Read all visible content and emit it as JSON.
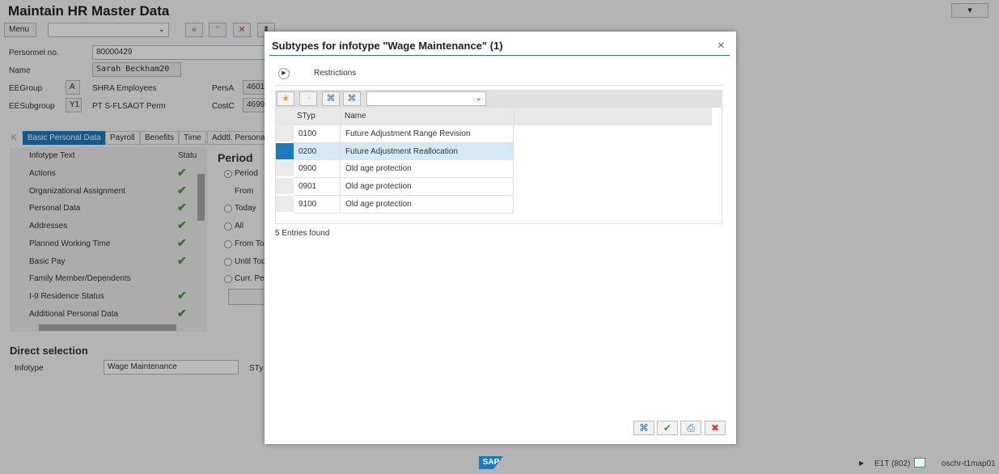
{
  "app": {
    "title": "Maintain HR Master Data",
    "menu_label": "Menu",
    "command_field": ""
  },
  "header": {
    "personnel_no_label": "Personnel no.",
    "personnel_no": "80000429",
    "name_label": "Name",
    "name": "Sarah Beckham20",
    "eegroup_label": "EEGroup",
    "eegroup_code": "A",
    "eegroup_text": "SHRA Employees",
    "eesubgroup_label": "EESubgroup",
    "eesubgroup_code": "Y1",
    "eesubgroup_text": "PT S-FLSAOT Perm",
    "persa_label": "PersA",
    "persa": "4601",
    "costc_label": "CostC",
    "costc": "4699"
  },
  "tabs": [
    "Basic Personal Data",
    "Payroll",
    "Benefits",
    "Time",
    "Addtl. Persona"
  ],
  "infotypes": {
    "col_text": "Infotype Text",
    "col_status": "Statu",
    "rows": [
      {
        "text": "Actions",
        "ok": true
      },
      {
        "text": "Organizational Assignment",
        "ok": true
      },
      {
        "text": "Personal Data",
        "ok": true
      },
      {
        "text": "Addresses",
        "ok": true
      },
      {
        "text": "Planned Working Time",
        "ok": true
      },
      {
        "text": "Basic Pay",
        "ok": true
      },
      {
        "text": "Family Member/Dependents",
        "ok": false
      },
      {
        "text": "I-9 Residence Status",
        "ok": true
      },
      {
        "text": "Additional Personal Data",
        "ok": true
      }
    ]
  },
  "period": {
    "title": "Period",
    "options": [
      "Period",
      "From",
      "Today",
      "All",
      "From Tod",
      "Until Tod",
      "Curr. Per"
    ]
  },
  "direct": {
    "title": "Direct selection",
    "infotype_label": "Infotype",
    "infotype_value": "Wage Maintenance",
    "sty_label": "STy"
  },
  "dialog": {
    "title": "Subtypes for infotype \"Wage Maintenance\" (1)",
    "restrictions": "Restrictions",
    "col_styp": "STyp",
    "col_name": "Name",
    "rows": [
      {
        "styp": "0100",
        "name": "Future Adjustment Range Revision",
        "selected": false
      },
      {
        "styp": "0200",
        "name": "Future Adjustment Reallocation",
        "selected": true
      },
      {
        "styp": "0900",
        "name": "Old age protection",
        "selected": false
      },
      {
        "styp": "0901",
        "name": "Old age protection",
        "selected": false
      },
      {
        "styp": "9100",
        "name": "Old age protection",
        "selected": false
      }
    ],
    "status": "5 Entries found"
  },
  "statusbar": {
    "system": "E1T (802)",
    "server": "oschr-t1map01",
    "logo": "SAP"
  },
  "colors": {
    "accent": "#1b7bbf",
    "selected_row": "#d4e9f5",
    "check": "#4a9b3a",
    "cancel": "#d9412a"
  }
}
